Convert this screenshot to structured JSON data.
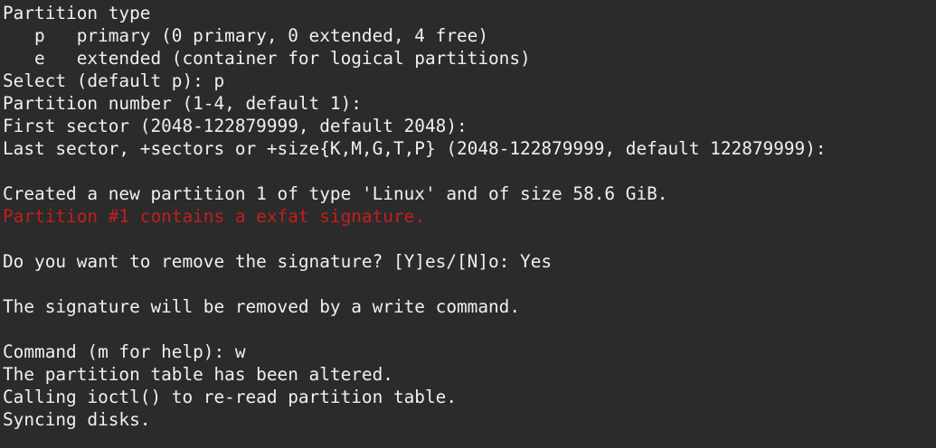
{
  "terminal": {
    "lines": [
      {
        "text": "Partition type",
        "style": "normal"
      },
      {
        "text": "   p   primary (0 primary, 0 extended, 4 free)",
        "style": "normal"
      },
      {
        "text": "   e   extended (container for logical partitions)",
        "style": "normal"
      },
      {
        "text": "Select (default p): p",
        "style": "normal"
      },
      {
        "text": "Partition number (1-4, default 1):",
        "style": "normal"
      },
      {
        "text": "First sector (2048-122879999, default 2048):",
        "style": "normal"
      },
      {
        "text": "Last sector, +sectors or +size{K,M,G,T,P} (2048-122879999, default 122879999):",
        "style": "normal"
      },
      {
        "text": "",
        "style": "normal"
      },
      {
        "text": "Created a new partition 1 of type 'Linux' and of size 58.6 GiB.",
        "style": "normal"
      },
      {
        "text": "Partition #1 contains a exfat signature.",
        "style": "warning"
      },
      {
        "text": "",
        "style": "normal"
      },
      {
        "text": "Do you want to remove the signature? [Y]es/[N]o: Yes",
        "style": "normal"
      },
      {
        "text": "",
        "style": "normal"
      },
      {
        "text": "The signature will be removed by a write command.",
        "style": "normal"
      },
      {
        "text": "",
        "style": "normal"
      },
      {
        "text": "Command (m for help): w",
        "style": "normal"
      },
      {
        "text": "The partition table has been altered.",
        "style": "normal"
      },
      {
        "text": "Calling ioctl() to re-read partition table.",
        "style": "normal"
      },
      {
        "text": "Syncing disks.",
        "style": "normal"
      }
    ],
    "colors": {
      "background": "#2b2b2b",
      "foreground": "#f0f0f0",
      "warning": "#c41e1e"
    }
  }
}
